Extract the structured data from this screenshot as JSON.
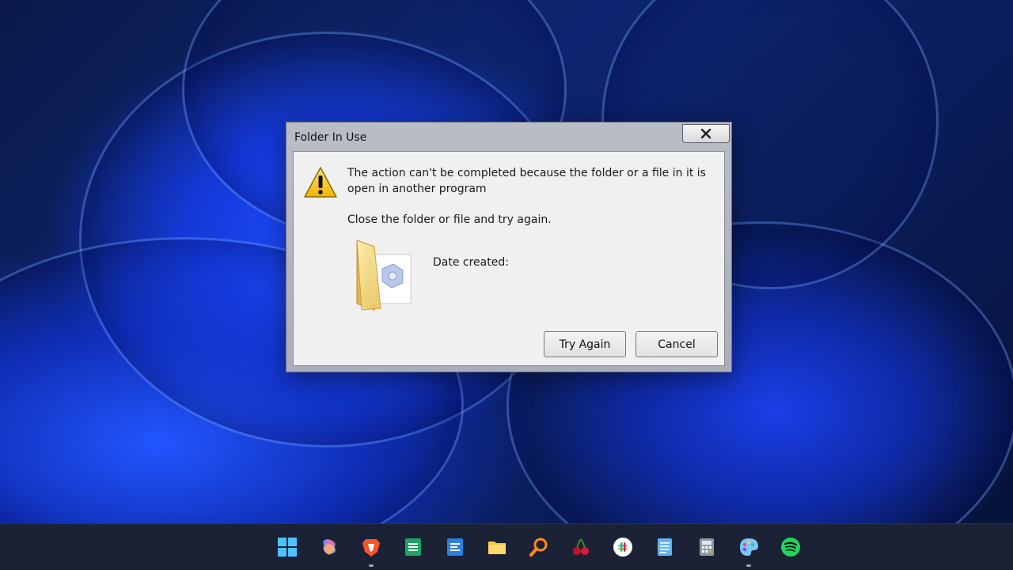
{
  "dialog": {
    "title": "Folder In Use",
    "message": "The action can't be completed because the folder or a file in it is open in another program",
    "instruction": "Close the folder or file and try again.",
    "date_created_label": "Date created:",
    "buttons": {
      "try_again": "Try Again",
      "cancel": "Cancel"
    },
    "icons": {
      "close": "close-icon",
      "warning": "warning-icon",
      "folder": "folder-icon"
    }
  },
  "taskbar": {
    "icons": [
      {
        "name": "windows-start-icon",
        "running": false
      },
      {
        "name": "copilot-icon",
        "running": false
      },
      {
        "name": "brave-browser-icon",
        "running": true
      },
      {
        "name": "spreadsheet-app-icon",
        "running": false
      },
      {
        "name": "document-app-icon",
        "running": false
      },
      {
        "name": "file-explorer-icon",
        "running": false
      },
      {
        "name": "search-magnifier-icon",
        "running": false
      },
      {
        "name": "cherry-app-icon",
        "running": false
      },
      {
        "name": "slack-icon",
        "running": false
      },
      {
        "name": "notepad-icon",
        "running": false
      },
      {
        "name": "calculator-icon",
        "running": false
      },
      {
        "name": "paint-icon",
        "running": true
      },
      {
        "name": "spotify-icon",
        "running": false
      }
    ]
  },
  "colors": {
    "wallpaper_blue": "#1f4dff",
    "taskbar_bg": "#1c2235",
    "dialog_client_bg": "#f0f0f0"
  }
}
